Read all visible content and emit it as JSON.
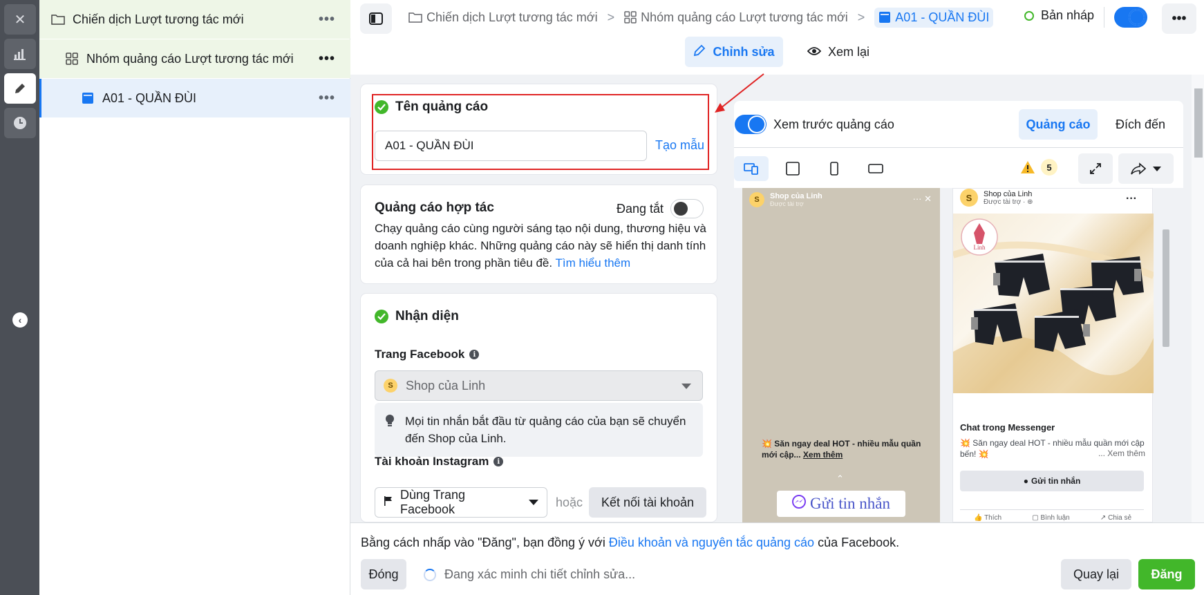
{
  "tree": {
    "campaign": "Chiến dịch Lượt tương tác mới",
    "adset": "Nhóm quảng cáo Lượt tương tác mới",
    "ad": "A01 - QUẦN ĐÙI",
    "more": "•••"
  },
  "rail": {
    "close": "✕",
    "collapse": "‹"
  },
  "breadcrumb": {
    "campaign": "Chiến dịch Lượt tương tác mới",
    "adset": "Nhóm quảng cáo Lượt tương tác mới",
    "ad": "A01 - QUẦN ĐÙI",
    "sep": ">"
  },
  "header": {
    "status": "Bản nháp",
    "more": "•••",
    "tab_edit": "Chỉnh sửa",
    "tab_review": "Xem lại"
  },
  "ad_name": {
    "title": "Tên quảng cáo",
    "value": "A01 - QUẦN ĐÙI",
    "template_link": "Tạo mẫu"
  },
  "collab": {
    "title": "Quảng cáo hợp tác",
    "state": "Đang tắt",
    "description": "Chạy quảng cáo cùng người sáng tạo nội dung, thương hiệu và doanh nghiệp khác. Những quảng cáo này sẽ hiển thị danh tính của cả hai bên trong phần tiêu đề.",
    "learn_more": "Tìm hiểu thêm"
  },
  "identity": {
    "title": "Nhận diện",
    "page_label": "Trang Facebook",
    "page_value": "Shop của Linh",
    "page_avatar": "S",
    "tip": "Mọi tin nhắn bắt đầu từ quảng cáo của bạn sẽ chuyển đến Shop của Linh.",
    "instagram_label": "Tài khoản Instagram",
    "instagram_value": "Dùng Trang Facebook",
    "or": "hoặc",
    "connect": "Kết nối tài khoản"
  },
  "preview": {
    "title": "Xem trước quảng cáo",
    "tab_ad": "Quảng cáo",
    "tab_destination": "Đích đến",
    "warnings": "5",
    "story": {
      "avatar": "S",
      "name": "Shop của Linh",
      "sponsored": "Được tài trợ",
      "caption": "💥 Săn ngay deal HOT - nhiều mẫu quần mới cập...",
      "see_more": "Xem thêm",
      "cta": "Gửi tin nhắn"
    },
    "feed": {
      "avatar": "S",
      "name": "Shop của Linh",
      "sponsored": "Được tài trợ · ⊕",
      "headline": "Chat trong Messenger",
      "text": "💥 Săn ngay deal HOT - nhiều mẫu quần mới cập bến! 💥",
      "see_more": "... Xem thêm",
      "cta": "Gửi tin nhắn",
      "like": "Thích",
      "comment": "Bình luận",
      "share": "Chia sẻ",
      "logo_text": "Linh"
    }
  },
  "footer": {
    "terms_prefix": "Bằng cách nhấp vào \"Đăng\", bạn đồng ý với",
    "terms_link": "Điều khoản và nguyên tắc quảng cáo",
    "terms_suffix": "của Facebook.",
    "close": "Đóng",
    "status": "Đang xác minh chi tiết chỉnh sửa...",
    "back": "Quay lại",
    "publish": "Đăng"
  },
  "colors": {
    "accent": "#1877f2",
    "success": "#42b72a",
    "highlight": "#e02424"
  }
}
